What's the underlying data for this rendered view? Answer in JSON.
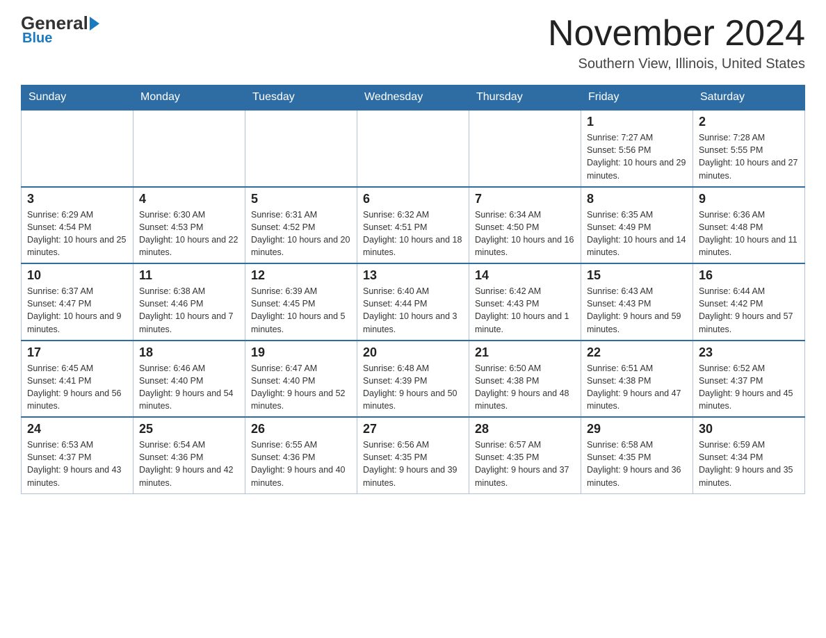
{
  "logo": {
    "general": "General",
    "blue": "Blue"
  },
  "title": "November 2024",
  "subtitle": "Southern View, Illinois, United States",
  "weekdays": [
    "Sunday",
    "Monday",
    "Tuesday",
    "Wednesday",
    "Thursday",
    "Friday",
    "Saturday"
  ],
  "weeks": [
    [
      {
        "day": "",
        "empty": true
      },
      {
        "day": "",
        "empty": true
      },
      {
        "day": "",
        "empty": true
      },
      {
        "day": "",
        "empty": true
      },
      {
        "day": "",
        "empty": true
      },
      {
        "day": "1",
        "sunrise": "Sunrise: 7:27 AM",
        "sunset": "Sunset: 5:56 PM",
        "daylight": "Daylight: 10 hours and 29 minutes."
      },
      {
        "day": "2",
        "sunrise": "Sunrise: 7:28 AM",
        "sunset": "Sunset: 5:55 PM",
        "daylight": "Daylight: 10 hours and 27 minutes."
      }
    ],
    [
      {
        "day": "3",
        "sunrise": "Sunrise: 6:29 AM",
        "sunset": "Sunset: 4:54 PM",
        "daylight": "Daylight: 10 hours and 25 minutes."
      },
      {
        "day": "4",
        "sunrise": "Sunrise: 6:30 AM",
        "sunset": "Sunset: 4:53 PM",
        "daylight": "Daylight: 10 hours and 22 minutes."
      },
      {
        "day": "5",
        "sunrise": "Sunrise: 6:31 AM",
        "sunset": "Sunset: 4:52 PM",
        "daylight": "Daylight: 10 hours and 20 minutes."
      },
      {
        "day": "6",
        "sunrise": "Sunrise: 6:32 AM",
        "sunset": "Sunset: 4:51 PM",
        "daylight": "Daylight: 10 hours and 18 minutes."
      },
      {
        "day": "7",
        "sunrise": "Sunrise: 6:34 AM",
        "sunset": "Sunset: 4:50 PM",
        "daylight": "Daylight: 10 hours and 16 minutes."
      },
      {
        "day": "8",
        "sunrise": "Sunrise: 6:35 AM",
        "sunset": "Sunset: 4:49 PM",
        "daylight": "Daylight: 10 hours and 14 minutes."
      },
      {
        "day": "9",
        "sunrise": "Sunrise: 6:36 AM",
        "sunset": "Sunset: 4:48 PM",
        "daylight": "Daylight: 10 hours and 11 minutes."
      }
    ],
    [
      {
        "day": "10",
        "sunrise": "Sunrise: 6:37 AM",
        "sunset": "Sunset: 4:47 PM",
        "daylight": "Daylight: 10 hours and 9 minutes."
      },
      {
        "day": "11",
        "sunrise": "Sunrise: 6:38 AM",
        "sunset": "Sunset: 4:46 PM",
        "daylight": "Daylight: 10 hours and 7 minutes."
      },
      {
        "day": "12",
        "sunrise": "Sunrise: 6:39 AM",
        "sunset": "Sunset: 4:45 PM",
        "daylight": "Daylight: 10 hours and 5 minutes."
      },
      {
        "day": "13",
        "sunrise": "Sunrise: 6:40 AM",
        "sunset": "Sunset: 4:44 PM",
        "daylight": "Daylight: 10 hours and 3 minutes."
      },
      {
        "day": "14",
        "sunrise": "Sunrise: 6:42 AM",
        "sunset": "Sunset: 4:43 PM",
        "daylight": "Daylight: 10 hours and 1 minute."
      },
      {
        "day": "15",
        "sunrise": "Sunrise: 6:43 AM",
        "sunset": "Sunset: 4:43 PM",
        "daylight": "Daylight: 9 hours and 59 minutes."
      },
      {
        "day": "16",
        "sunrise": "Sunrise: 6:44 AM",
        "sunset": "Sunset: 4:42 PM",
        "daylight": "Daylight: 9 hours and 57 minutes."
      }
    ],
    [
      {
        "day": "17",
        "sunrise": "Sunrise: 6:45 AM",
        "sunset": "Sunset: 4:41 PM",
        "daylight": "Daylight: 9 hours and 56 minutes."
      },
      {
        "day": "18",
        "sunrise": "Sunrise: 6:46 AM",
        "sunset": "Sunset: 4:40 PM",
        "daylight": "Daylight: 9 hours and 54 minutes."
      },
      {
        "day": "19",
        "sunrise": "Sunrise: 6:47 AM",
        "sunset": "Sunset: 4:40 PM",
        "daylight": "Daylight: 9 hours and 52 minutes."
      },
      {
        "day": "20",
        "sunrise": "Sunrise: 6:48 AM",
        "sunset": "Sunset: 4:39 PM",
        "daylight": "Daylight: 9 hours and 50 minutes."
      },
      {
        "day": "21",
        "sunrise": "Sunrise: 6:50 AM",
        "sunset": "Sunset: 4:38 PM",
        "daylight": "Daylight: 9 hours and 48 minutes."
      },
      {
        "day": "22",
        "sunrise": "Sunrise: 6:51 AM",
        "sunset": "Sunset: 4:38 PM",
        "daylight": "Daylight: 9 hours and 47 minutes."
      },
      {
        "day": "23",
        "sunrise": "Sunrise: 6:52 AM",
        "sunset": "Sunset: 4:37 PM",
        "daylight": "Daylight: 9 hours and 45 minutes."
      }
    ],
    [
      {
        "day": "24",
        "sunrise": "Sunrise: 6:53 AM",
        "sunset": "Sunset: 4:37 PM",
        "daylight": "Daylight: 9 hours and 43 minutes."
      },
      {
        "day": "25",
        "sunrise": "Sunrise: 6:54 AM",
        "sunset": "Sunset: 4:36 PM",
        "daylight": "Daylight: 9 hours and 42 minutes."
      },
      {
        "day": "26",
        "sunrise": "Sunrise: 6:55 AM",
        "sunset": "Sunset: 4:36 PM",
        "daylight": "Daylight: 9 hours and 40 minutes."
      },
      {
        "day": "27",
        "sunrise": "Sunrise: 6:56 AM",
        "sunset": "Sunset: 4:35 PM",
        "daylight": "Daylight: 9 hours and 39 minutes."
      },
      {
        "day": "28",
        "sunrise": "Sunrise: 6:57 AM",
        "sunset": "Sunset: 4:35 PM",
        "daylight": "Daylight: 9 hours and 37 minutes."
      },
      {
        "day": "29",
        "sunrise": "Sunrise: 6:58 AM",
        "sunset": "Sunset: 4:35 PM",
        "daylight": "Daylight: 9 hours and 36 minutes."
      },
      {
        "day": "30",
        "sunrise": "Sunrise: 6:59 AM",
        "sunset": "Sunset: 4:34 PM",
        "daylight": "Daylight: 9 hours and 35 minutes."
      }
    ]
  ]
}
